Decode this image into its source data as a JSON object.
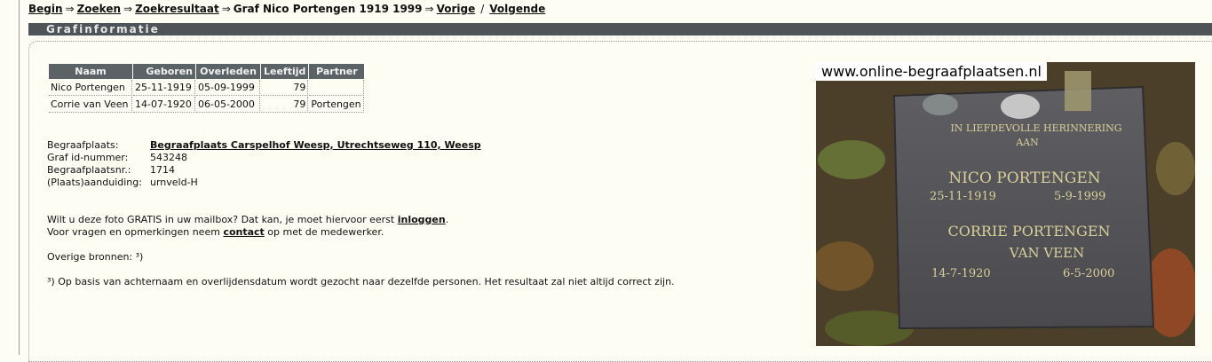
{
  "breadcrumb": {
    "begin": "Begin",
    "zoeken": "Zoeken",
    "zoekresultaat": "Zoekresultaat",
    "current": "Graf Nico Portengen 1919 1999",
    "vorige": "Vorige",
    "volgende": "Volgende",
    "arrow": "⇒",
    "slash": "/"
  },
  "section": {
    "title": "Grafinformatie"
  },
  "table": {
    "headers": [
      "Naam",
      "Geboren",
      "Overleden",
      "Leeftijd",
      "Partner"
    ],
    "rows": [
      [
        "Nico Portengen",
        "25-11-1919",
        "05-09-1999",
        "79",
        ""
      ],
      [
        "Corrie van Veen",
        "14-07-1920",
        "06-05-2000",
        "79",
        "Portengen"
      ]
    ]
  },
  "info": {
    "begraafplaats_label": "Begraafplaats:",
    "begraafplaats_value": "Begraafplaats Carspelhof Weesp, Utrechtseweg 110, Weesp",
    "graf_id_label": "Graf id-nummer:",
    "graf_id_value": "543248",
    "begraafplaatsnr_label": "Begraafplaatsnr.:",
    "begraafplaatsnr_value": "1714",
    "aanduiding_label": "(Plaats)aanduiding:",
    "aanduiding_value": "urnveld-H"
  },
  "texts": {
    "mail_before": "Wilt u deze foto GRATIS in uw mailbox? Dat kan, je moet hiervoor eerst ",
    "mail_link": "inloggen",
    "mail_after": ".",
    "contact_before": "Voor vragen en opmerkingen neem ",
    "contact_link": "contact",
    "contact_after": " op met de medewerker.",
    "overige": "Overige bronnen: ³)",
    "footnote": "³) Op basis van achternaam en overlijdensdatum wordt gezocht naar dezelfde personen. Het resultaat zal niet altijd correct zijn."
  },
  "photo": {
    "watermark": "www.online-begraafplaatsen.nl",
    "stone_line1": "IN LIEFDEVOLLE HERINNERING",
    "stone_line2": "AAN",
    "stone_name1": "NICO PORTENGEN",
    "stone_date1a": "25-11-1919",
    "stone_date1b": "5-9-1999",
    "stone_name2": "CORRIE PORTENGEN",
    "stone_name2b": "VAN VEEN",
    "stone_date2a": "14-7-1920",
    "stone_date2b": "6-5-2000"
  }
}
